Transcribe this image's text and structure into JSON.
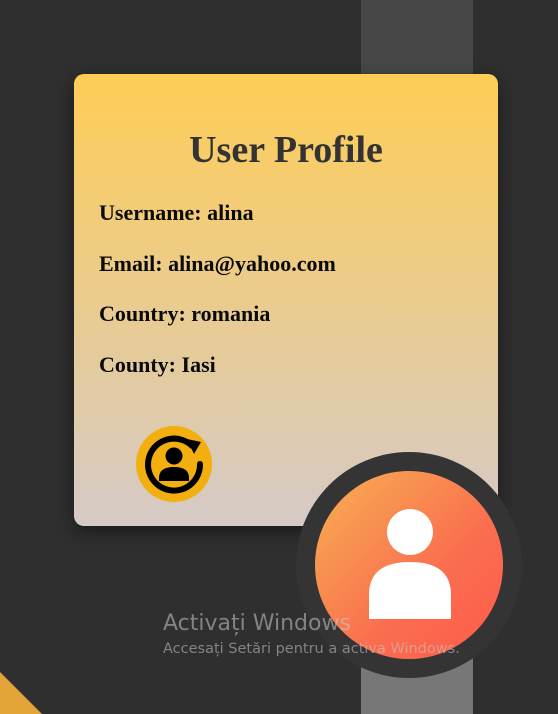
{
  "profile": {
    "title": "User Profile",
    "fields": [
      {
        "label": "Username:",
        "value": "alina"
      },
      {
        "label": "Email:",
        "value": "alina@yahoo.com"
      },
      {
        "label": "Country:",
        "value": "romania"
      },
      {
        "label": "County:",
        "value": "Iasi"
      }
    ],
    "switch_icon": "user-refresh-icon",
    "avatar_icon": "user-avatar-icon"
  },
  "watermark": {
    "title": "Activați Windows",
    "subtitle": "Accesați Setări pentru a activa Windows."
  },
  "colors": {
    "background": "#2f2f2f",
    "card_top": "#ffcd55",
    "card_bottom": "#d5cac7",
    "button": "#f3ae0f",
    "avatar_start": "#f7b152",
    "avatar_end": "#ff5a4a"
  }
}
